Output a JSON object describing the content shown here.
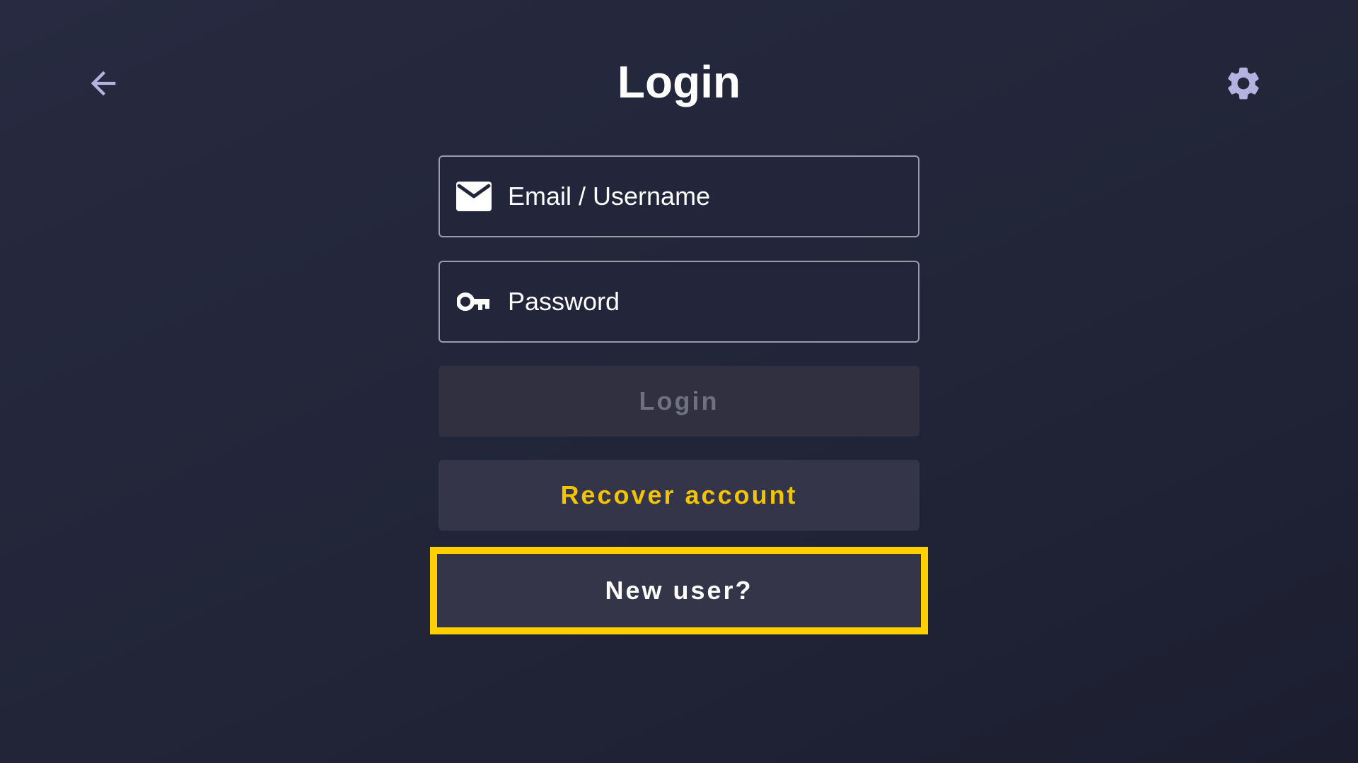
{
  "header": {
    "title": "Login",
    "back_icon": "arrow-left-icon",
    "settings_icon": "gear-icon"
  },
  "form": {
    "email": {
      "icon": "envelope-icon",
      "placeholder": "Email / Username",
      "value": ""
    },
    "password": {
      "icon": "key-icon",
      "placeholder": "Password",
      "value": ""
    },
    "login_label": "Login",
    "recover_label": "Recover account",
    "new_user_label": "New user?"
  },
  "colors": {
    "accent": "#ffd000",
    "recover_text": "#f5c400",
    "disabled_text": "#707180",
    "icon_muted": "#b3b2e0"
  }
}
